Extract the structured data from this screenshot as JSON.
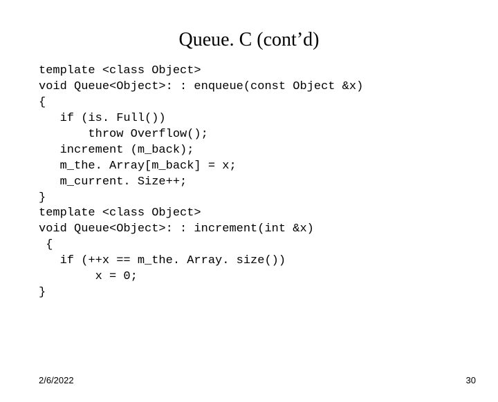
{
  "title": "Queue. C (cont’d)",
  "code_lines": [
    "template <class Object>",
    "void Queue<Object>: : enqueue(const Object &x)",
    "{",
    "   if (is. Full())",
    "       throw Overflow();",
    "   increment (m_back);",
    "   m_the. Array[m_back] = x;",
    "   m_current. Size++;",
    "}",
    "template <class Object>",
    "void Queue<Object>: : increment(int &x)",
    " {",
    "   if (++x == m_the. Array. size())",
    "        x = 0;",
    "}"
  ],
  "footer": {
    "date": "2/6/2022",
    "page": "30"
  }
}
